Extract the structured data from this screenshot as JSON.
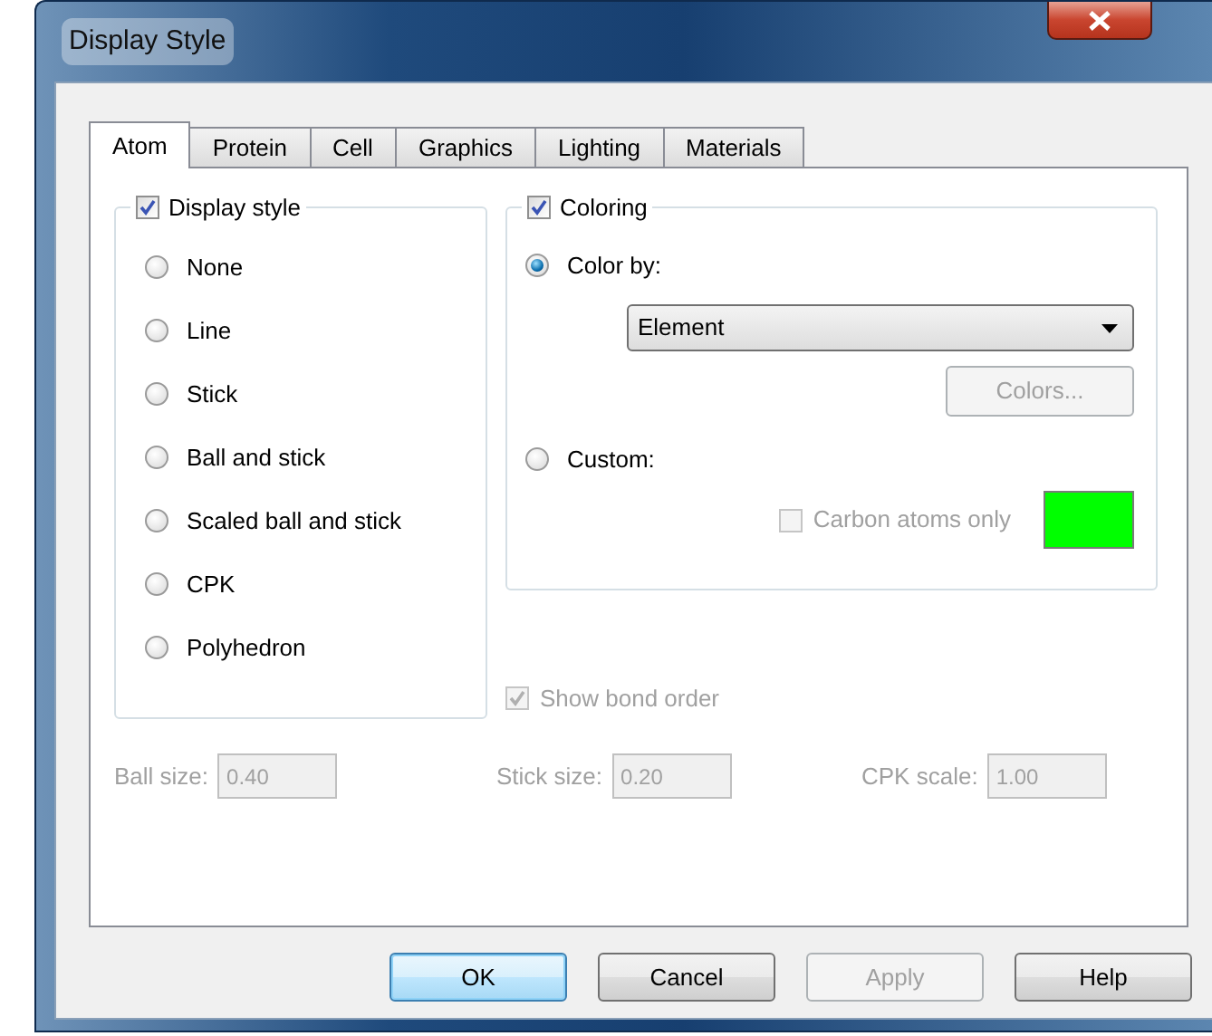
{
  "window": {
    "title": "Display Style"
  },
  "tabs": [
    {
      "label": "Atom",
      "selected": true
    },
    {
      "label": "Protein",
      "selected": false
    },
    {
      "label": "Cell",
      "selected": false
    },
    {
      "label": "Graphics",
      "selected": false
    },
    {
      "label": "Lighting",
      "selected": false
    },
    {
      "label": "Materials",
      "selected": false
    }
  ],
  "display_style": {
    "label": "Display style",
    "checked": true,
    "options": [
      {
        "label": "None",
        "selected": false
      },
      {
        "label": "Line",
        "selected": false
      },
      {
        "label": "Stick",
        "selected": false
      },
      {
        "label": "Ball and stick",
        "selected": false
      },
      {
        "label": "Scaled ball and stick",
        "selected": false
      },
      {
        "label": "CPK",
        "selected": false
      },
      {
        "label": "Polyhedron",
        "selected": false
      }
    ]
  },
  "coloring": {
    "label": "Coloring",
    "checked": true,
    "color_by": {
      "label": "Color by:",
      "selected": true
    },
    "dropdown": {
      "value": "Element"
    },
    "colors_button": {
      "label": "Colors...",
      "disabled": true
    },
    "custom": {
      "label": "Custom:",
      "selected": false
    },
    "carbon_atoms_only": {
      "label": "Carbon atoms only",
      "checked": false,
      "disabled": true
    },
    "swatch": {
      "color": "#00ff00"
    }
  },
  "show_bond_order": {
    "label": "Show bond order",
    "checked": true,
    "disabled": true
  },
  "sizes": [
    {
      "label": "Ball size:",
      "value": "0.40",
      "disabled": true
    },
    {
      "label": "Stick size:",
      "value": "0.20",
      "disabled": true
    },
    {
      "label": "CPK scale:",
      "value": "1.00",
      "disabled": true
    }
  ],
  "buttons": [
    {
      "label": "OK",
      "kind": "default",
      "disabled": false
    },
    {
      "label": "Cancel",
      "kind": "normal",
      "disabled": false
    },
    {
      "label": "Apply",
      "kind": "normal",
      "disabled": true
    },
    {
      "label": "Help",
      "kind": "normal",
      "disabled": false
    }
  ]
}
